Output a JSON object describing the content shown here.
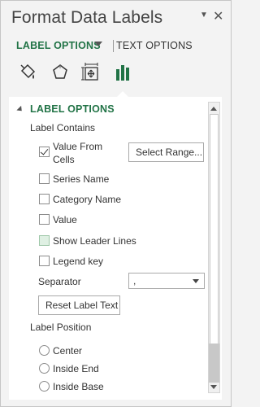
{
  "header": {
    "title": "Format Data Labels",
    "menu_icon": "dropdown-caret-icon",
    "close_icon": "close-icon"
  },
  "tabs": {
    "active": "LABEL OPTIONS",
    "inactive": "TEXT OPTIONS"
  },
  "icon_toolbar": [
    "fill-line-icon",
    "effects-pentagon-icon",
    "size-properties-icon",
    "label-options-bar-icon"
  ],
  "section": {
    "title": "LABEL OPTIONS"
  },
  "label_contains": {
    "heading": "Label Contains",
    "items": [
      {
        "line1": "Value From",
        "line2": "Cells",
        "checked": true
      },
      {
        "label": "Series Name",
        "checked": false
      },
      {
        "label": "Category Name",
        "checked": false
      },
      {
        "label": "Value",
        "checked": false
      },
      {
        "label": "Show Leader Lines",
        "checked": false
      },
      {
        "label": "Legend key",
        "checked": false
      }
    ],
    "select_range_button": "Select Range..."
  },
  "separator": {
    "label": "Separator",
    "value": ","
  },
  "reset_button": "Reset Label Text",
  "label_position": {
    "heading": "Label Position",
    "options": [
      "Center",
      "Inside End",
      "Inside Base"
    ]
  },
  "colors": {
    "accent": "#217346",
    "pane_bg": "#f3f3f3",
    "content_bg": "#ffffff"
  }
}
